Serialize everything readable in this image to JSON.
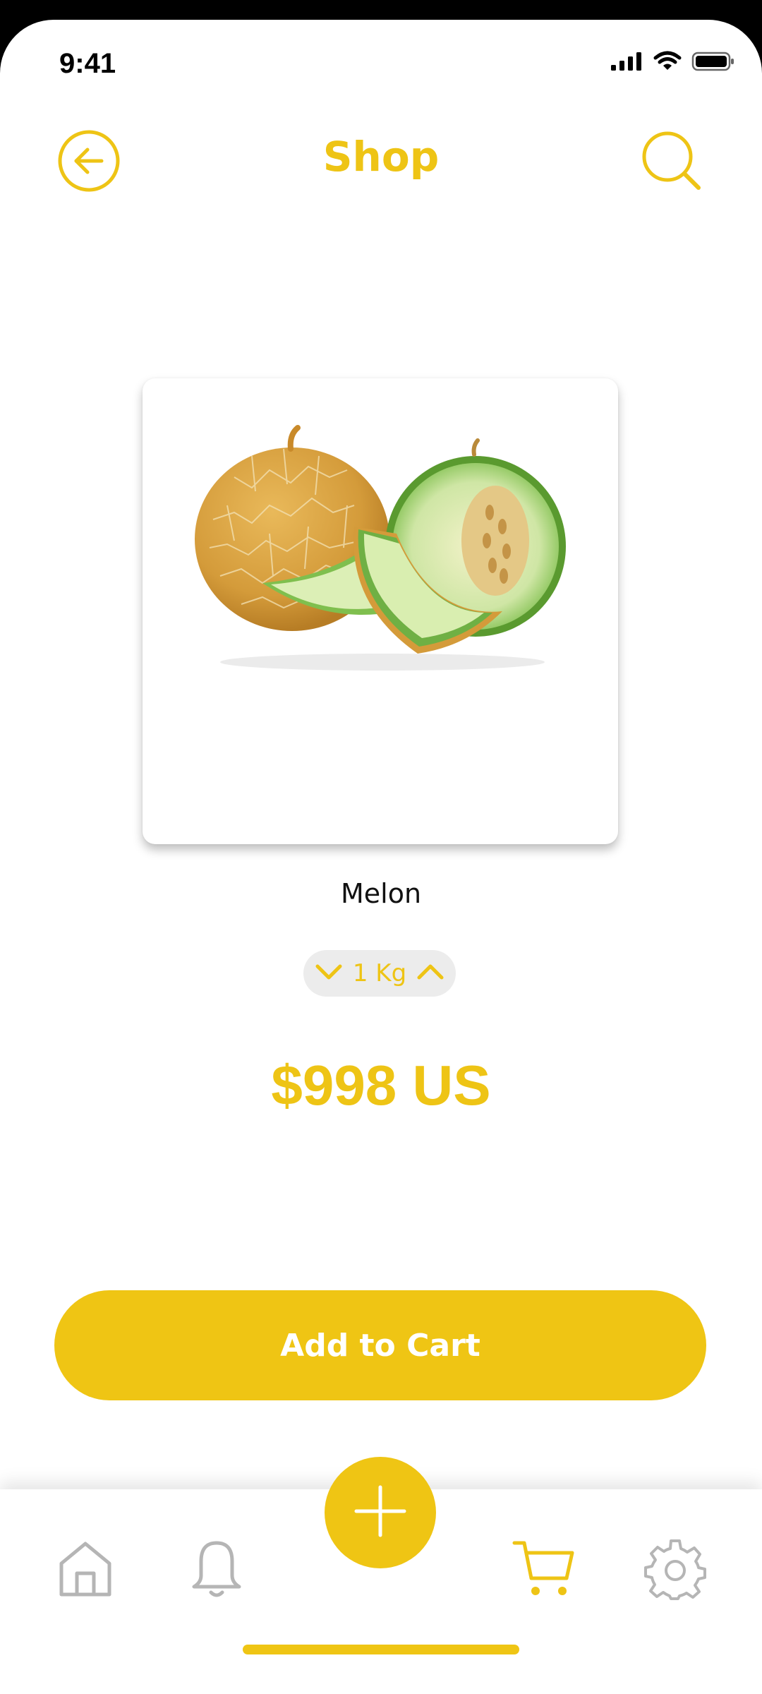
{
  "status_bar": {
    "time": "9:41",
    "icons": [
      "signal-icon",
      "wifi-icon",
      "battery-icon"
    ]
  },
  "header": {
    "title": "Shop",
    "back_icon": "arrow-left-circle-icon",
    "search_icon": "search-icon"
  },
  "product": {
    "name": "Melon",
    "image": "melon-image",
    "quantity": "1 Kg",
    "price": "$998 US"
  },
  "actions": {
    "add_to_cart_label": "Add to Cart"
  },
  "bottom_nav": {
    "items": [
      "home-icon",
      "bell-icon",
      "plus-icon",
      "cart-icon",
      "gear-icon"
    ],
    "active": "cart-icon"
  },
  "colors": {
    "accent": "#efc514",
    "inactive_icon": "#b5b5b5",
    "background": "#ffffff"
  }
}
